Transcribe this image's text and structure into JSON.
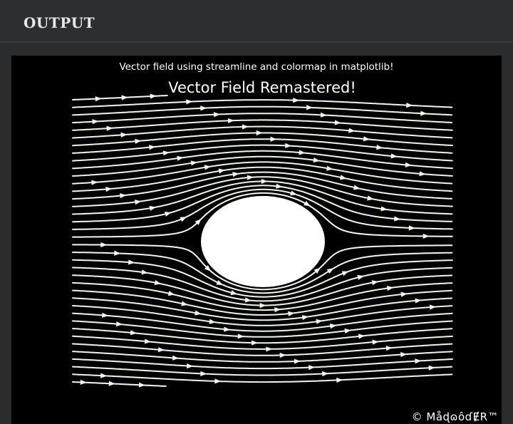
{
  "header": {
    "title": "OUTPUT"
  },
  "output": {
    "caption": "Vector field using streamline and colormap in matplotlib!",
    "watermark": "© MåɖɷôɗɆR™"
  },
  "chart_data": {
    "type": "streamplot",
    "title": "Vector Field Remastered!",
    "field": "uniform flow past a cylinder (potential flow)",
    "colormap": "PiYG",
    "color_by": "flow speed",
    "obstacle": {
      "shape": "circle",
      "color": "#ffffff"
    },
    "background": "#000000",
    "axes_visible": false,
    "grid": false,
    "flow_direction": "left-to-right"
  }
}
